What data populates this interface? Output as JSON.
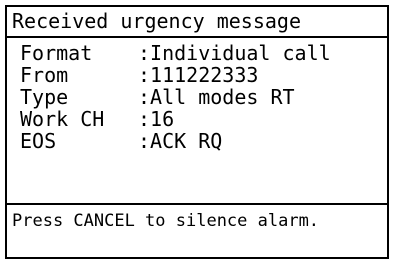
{
  "dialog": {
    "title": "Received urgency message",
    "fields": [
      {
        "label": "Format",
        "value": ":Individual call"
      },
      {
        "label": "From",
        "value": ":111222333"
      },
      {
        "label": "Type",
        "value": ":All modes RT"
      },
      {
        "label": "Work CH",
        "value": ":16"
      },
      {
        "label": "EOS",
        "value": ":ACK RQ"
      }
    ],
    "footer": "Press CANCEL to silence alarm."
  }
}
